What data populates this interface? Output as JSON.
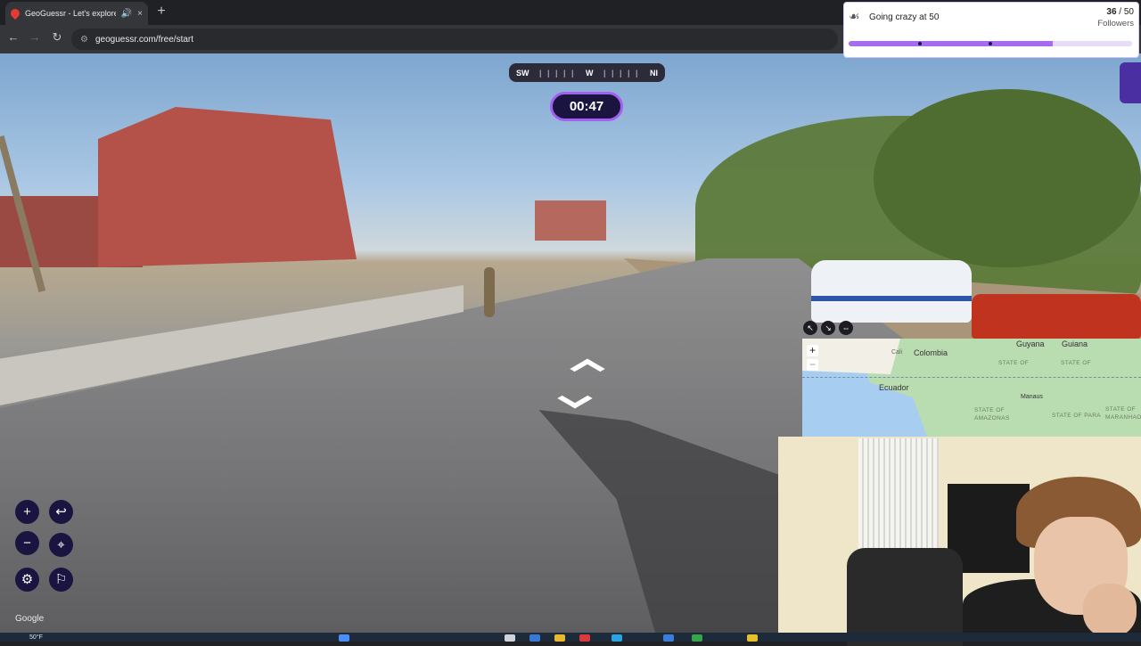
{
  "browser": {
    "tab_title": "GeoGuessr - Let's explore t",
    "url": "geoguessr.com/free/start",
    "back_icon": "←",
    "forward_icon": "→",
    "reload_icon": "↻",
    "audio_icon": "🔊",
    "close_tab_icon": "×",
    "new_tab_icon": "+"
  },
  "compass": {
    "left": "SW",
    "center": "W",
    "right": "NI",
    "ticks": "| | | | |"
  },
  "timer": "00:47",
  "follower_goal": {
    "title": "Going crazy at 50",
    "current": "36",
    "separator": " / ",
    "target": "50",
    "label": "Followers",
    "progress": 0.72
  },
  "minimap": {
    "labels": {
      "colombia": "Colombia",
      "ecuador": "Ecuador",
      "guyana": "Guyana",
      "guiana": "Guiana",
      "manaus": "Manaus",
      "cali": "Cali",
      "amazonas": "STATE OF AMAZONAS",
      "para": "STATE OF PARA",
      "maranhao": "STATE OF MARANHAO",
      "state_of": "STATE OF"
    },
    "zoom_in": "+",
    "zoom_out": "−",
    "tools": [
      "↖",
      "↘",
      "⇔"
    ]
  },
  "controls": {
    "zoom_in": "+",
    "zoom_out": "−",
    "undo": "↩",
    "checkpoint": "⌖",
    "settings": "⚙",
    "flag": "⚐"
  },
  "google_logo": "Google",
  "taskbar": {
    "weather": "50°F"
  },
  "colors": {
    "accent": "#a35ff0",
    "timer_bg": "#1a1440",
    "goal_fill": "#a56cf0"
  }
}
